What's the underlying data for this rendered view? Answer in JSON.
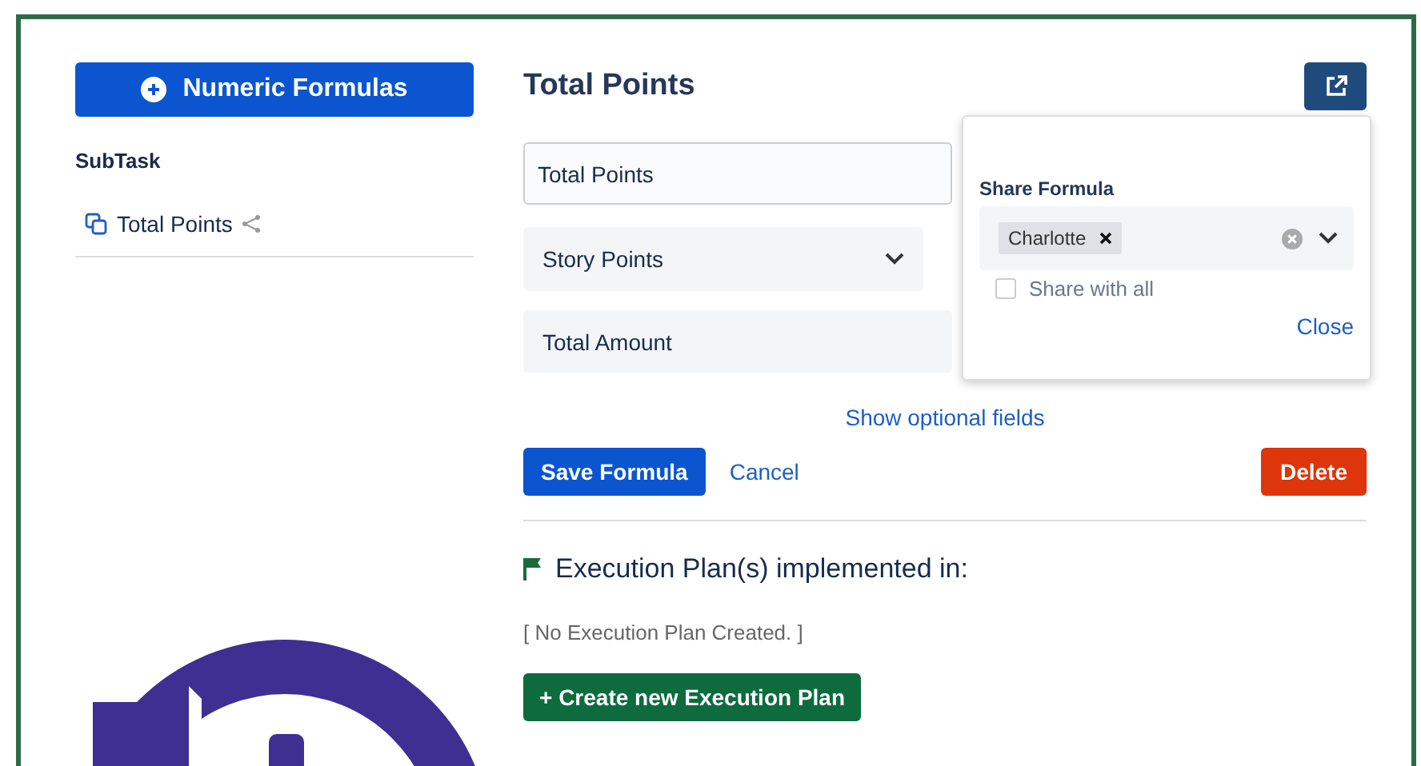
{
  "sidebar": {
    "add_button": "Numeric Formulas",
    "group": "SubTask",
    "items": [
      {
        "label": "Total Points",
        "shared": true
      }
    ]
  },
  "editor": {
    "title": "Total Points",
    "fields": [
      {
        "kind": "input",
        "value": "Total Points"
      },
      {
        "kind": "dropdown",
        "value": "Story Points"
      },
      {
        "kind": "box",
        "value": "Total Amount"
      }
    ],
    "optional_link": "Show optional fields",
    "save": "Save Formula",
    "cancel": "Cancel",
    "delete": "Delete"
  },
  "share_popover": {
    "label": "Share Formula",
    "tags": [
      "Charlotte"
    ],
    "share_with_all": {
      "label": "Share with all",
      "checked": false
    },
    "close": "Close"
  },
  "execution": {
    "heading": "Execution Plan(s) implemented in:",
    "empty": "[ No Execution Plan Created. ]",
    "create": "+ Create new Execution Plan"
  }
}
